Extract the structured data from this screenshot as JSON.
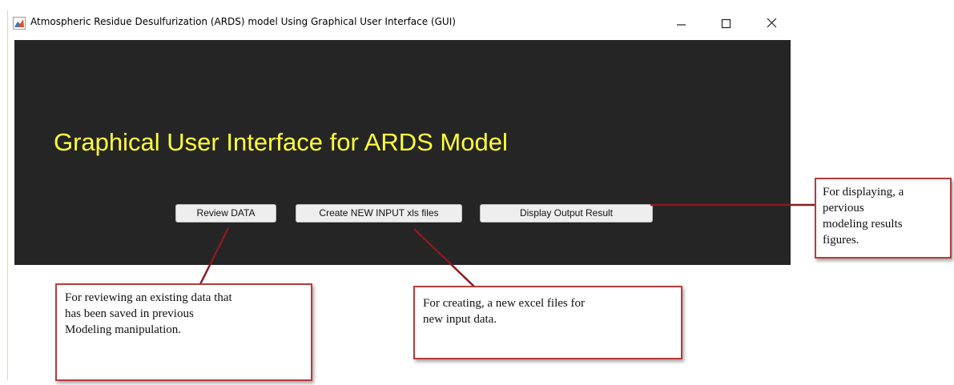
{
  "window": {
    "title": "Atmospheric Residue Desulfurization (ARDS) model  Using  Graphical  User Interface (GUI)",
    "icon": "matlab-figure-icon",
    "controls": [
      "minimize-icon",
      "maximize-icon",
      "close-icon"
    ]
  },
  "main": {
    "heading": "Graphical User Interface for ARDS Model",
    "background_color": "#252525",
    "heading_color": "#ffff3a",
    "buttons": [
      {
        "label": "Review DATA"
      },
      {
        "label": "Create NEW INPUT xls files"
      },
      {
        "label": "Display Output Result"
      }
    ]
  },
  "callouts": {
    "review": {
      "lines": [
        "For reviewing an existing data that",
        "has been saved in previous",
        "Modeling manipulation."
      ]
    },
    "create": {
      "lines": [
        "For creating, a new excel files for",
        "new input data."
      ]
    },
    "display": {
      "lines": [
        "For displaying, a",
        "pervious",
        "modeling results",
        "figures."
      ]
    },
    "border_color": "#b73b3b"
  }
}
